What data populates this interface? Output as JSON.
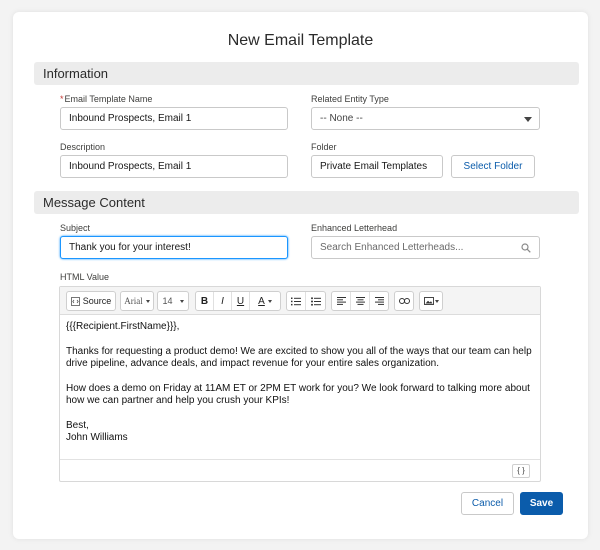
{
  "modal": {
    "title": "New Email Template"
  },
  "sections": {
    "information": "Information",
    "message_content": "Message Content"
  },
  "fields": {
    "template_name": {
      "label": "Email Template Name",
      "required_mark": "*",
      "value": "Inbound Prospects, Email 1"
    },
    "related_entity": {
      "label": "Related Entity Type",
      "value": "-- None --"
    },
    "description": {
      "label": "Description",
      "value": "Inbound Prospects, Email 1"
    },
    "folder": {
      "label": "Folder",
      "value": "Private Email Templates",
      "button": "Select Folder"
    },
    "subject": {
      "label": "Subject",
      "value": "Thank you for your interest!"
    },
    "letterhead": {
      "label": "Enhanced Letterhead",
      "placeholder": "Search Enhanced Letterheads..."
    },
    "html_value": {
      "label": "HTML Value"
    }
  },
  "toolbar": {
    "source": "Source",
    "font": "Arial",
    "size": "14",
    "bold": "B",
    "italic": "I",
    "underline": "U",
    "text_color": "A"
  },
  "editor": {
    "lines": [
      "{{{Recipient.FirstName}}},",
      "Thanks for requesting a product demo! We are excited to show you all of the ways that our team can help drive pipeline, advance deals, and impact revenue for your entire sales organization.",
      "How does a demo on Friday at 11AM ET or 2PM ET work for you? We look forward to talking more about how we can partner and help you crush your KPIs!"
    ],
    "closing": "Best,",
    "signature": "John Williams",
    "merge_button": "{ }"
  },
  "actions": {
    "cancel": "Cancel",
    "save": "Save"
  },
  "colors": {
    "brand": "#0b5cab",
    "focus": "#1b96ff",
    "required": "#c23934"
  }
}
